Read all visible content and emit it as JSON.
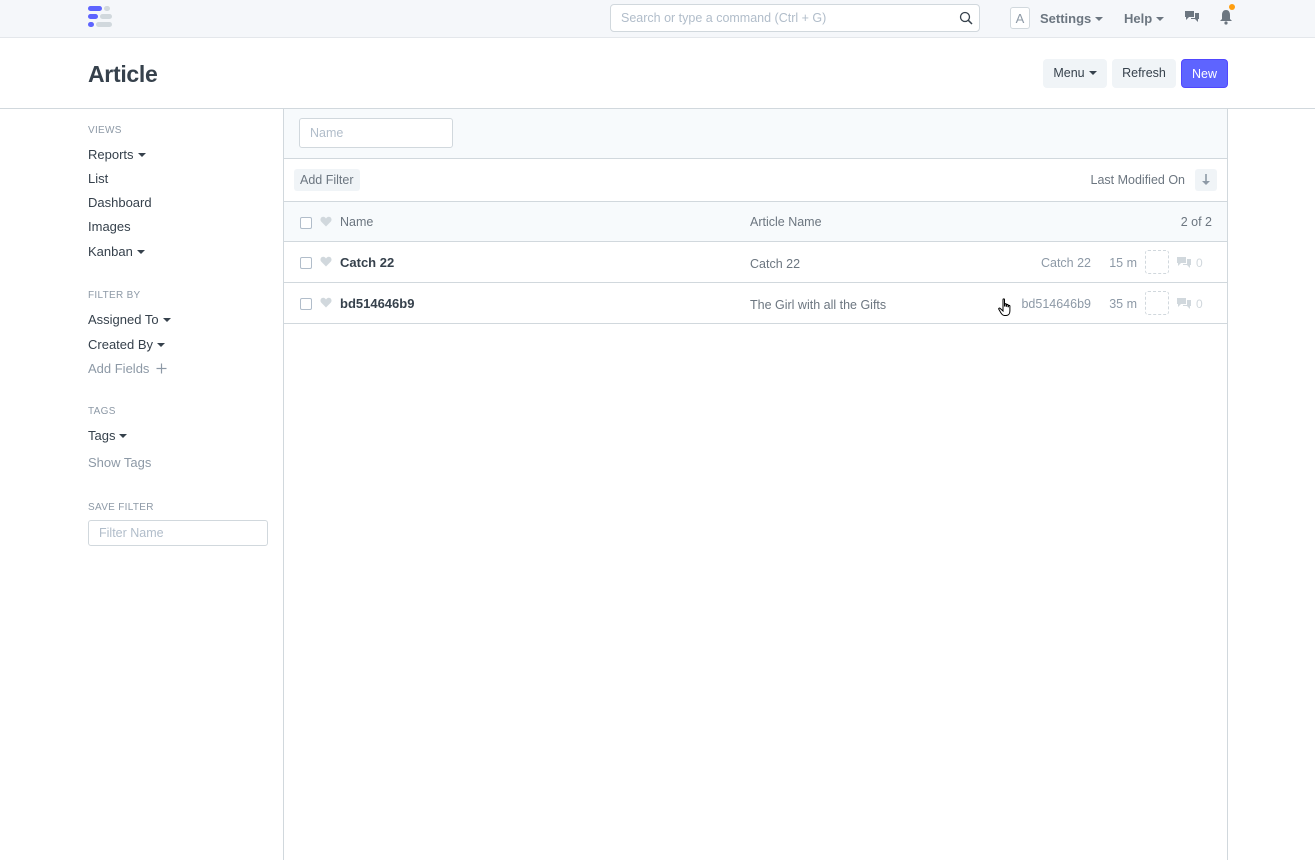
{
  "navbar": {
    "search_placeholder": "Search or type a command (Ctrl + G)",
    "avatar_letter": "A",
    "settings_label": "Settings",
    "help_label": "Help"
  },
  "page": {
    "title": "Article",
    "menu_label": "Menu",
    "refresh_label": "Refresh",
    "new_label": "New"
  },
  "sidebar": {
    "views_heading": "VIEWS",
    "views": [
      "Reports",
      "List",
      "Dashboard",
      "Images",
      "Kanban"
    ],
    "filter_heading": "FILTER BY",
    "assigned_to": "Assigned To",
    "created_by": "Created By",
    "add_fields": "Add Fields",
    "tags_heading": "TAGS",
    "tags_label": "Tags",
    "show_tags": "Show Tags",
    "save_filter_heading": "SAVE FILTER",
    "filter_name_placeholder": "Filter Name"
  },
  "list": {
    "name_placeholder": "Name",
    "add_filter": "Add Filter",
    "sort_label": "Last Modified On",
    "header": {
      "name": "Name",
      "article_name": "Article Name",
      "count": "2 of 2"
    },
    "rows": [
      {
        "name": "Catch 22",
        "article_name": "Catch 22",
        "title": "Catch 22",
        "modified": "15 m",
        "comments": "0"
      },
      {
        "name": "bd514646b9",
        "article_name": "The Girl with all the Gifts",
        "title": "bd514646b9",
        "modified": "35 m",
        "comments": "0"
      }
    ]
  },
  "colors": {
    "primary": "#5e64ff",
    "text": "#36414c",
    "muted": "#8d99a6",
    "border": "#d1d8dd",
    "notification": "#ff9e0f"
  }
}
